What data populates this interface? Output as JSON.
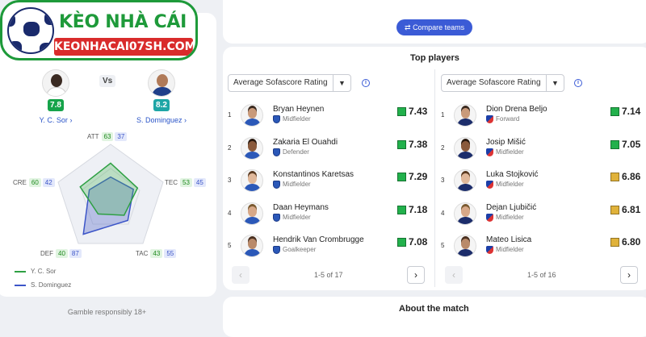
{
  "logo": {
    "brand": "KÈO NHÀ CÁI",
    "domain": "KEONHACAI07SH.COM"
  },
  "comparison": {
    "vs_label": "Vs",
    "player_a": {
      "name": "Y. C. Sor",
      "rating": "7.8",
      "color": "#16a34a"
    },
    "player_b": {
      "name": "S. Dominguez",
      "rating": "8.2",
      "color": "#1ea6a6"
    },
    "stats": {
      "att": {
        "label": "ATT",
        "a": "63",
        "b": "37"
      },
      "tec": {
        "label": "TEC",
        "a": "53",
        "b": "45"
      },
      "tac": {
        "label": "TAC",
        "a": "43",
        "b": "55"
      },
      "def": {
        "label": "DEF",
        "a": "40",
        "b": "87"
      },
      "cre": {
        "label": "CRE",
        "a": "60",
        "b": "42"
      }
    },
    "legend_a": "Y. C. Sor",
    "legend_b": "S. Dominguez",
    "color_a": "#2ea043",
    "color_b": "#3c55c8"
  },
  "gamble_text": "Gamble responsibly 18+",
  "compare_button": "Compare teams",
  "top_players": {
    "title": "Top players",
    "left": {
      "dropdown": "Average Sofascore Rating",
      "pager": "1-5 of 17",
      "players": [
        {
          "rank": "1",
          "name": "Bryan Heynen",
          "position": "Midfielder",
          "rating": "7.43",
          "color": "#22b14c"
        },
        {
          "rank": "2",
          "name": "Zakaria El Ouahdi",
          "position": "Defender",
          "rating": "7.38",
          "color": "#22b14c"
        },
        {
          "rank": "3",
          "name": "Konstantinos Karetsas",
          "position": "Midfielder",
          "rating": "7.29",
          "color": "#22b14c"
        },
        {
          "rank": "4",
          "name": "Daan Heymans",
          "position": "Midfielder",
          "rating": "7.18",
          "color": "#22b14c"
        },
        {
          "rank": "5",
          "name": "Hendrik Van Crombrugge",
          "position": "Goalkeeper",
          "rating": "7.08",
          "color": "#22b14c"
        }
      ]
    },
    "right": {
      "dropdown": "Average Sofascore Rating",
      "pager": "1-5 of 16",
      "players": [
        {
          "rank": "1",
          "name": "Dion Drena Beljo",
          "position": "Forward",
          "rating": "7.14",
          "color": "#22b14c"
        },
        {
          "rank": "2",
          "name": "Josip Mišić",
          "position": "Midfielder",
          "rating": "7.05",
          "color": "#22b14c"
        },
        {
          "rank": "3",
          "name": "Luka Stojković",
          "position": "Midfielder",
          "rating": "6.86",
          "color": "#e0b23a"
        },
        {
          "rank": "4",
          "name": "Dejan Ljubičić",
          "position": "Midfielder",
          "rating": "6.81",
          "color": "#e0b23a"
        },
        {
          "rank": "5",
          "name": "Mateo Lisica",
          "position": "Midfielder",
          "rating": "6.80",
          "color": "#e0b23a"
        }
      ]
    }
  },
  "about_title": "About the match"
}
